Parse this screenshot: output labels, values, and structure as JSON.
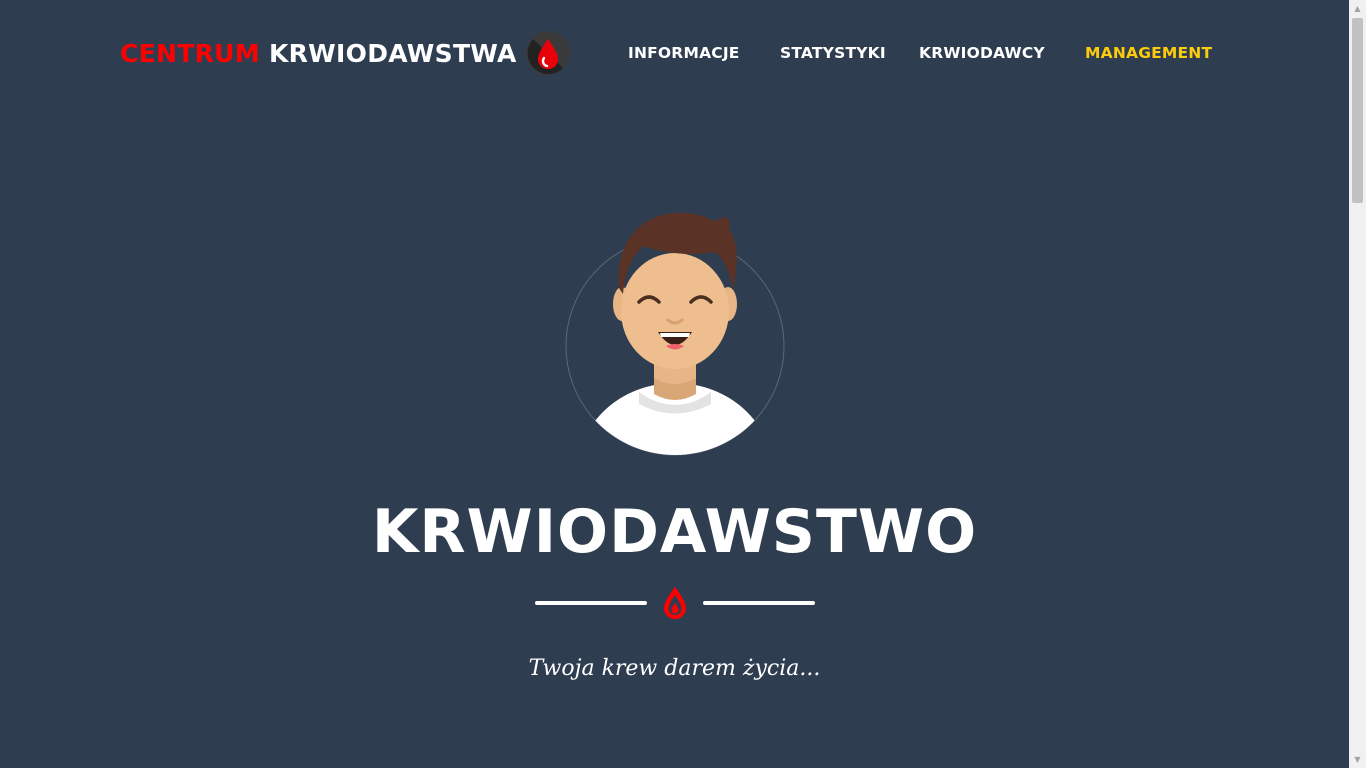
{
  "brand": {
    "part1": "CENTRUM",
    "part2": "KRWIODAWSTWA",
    "logo_icon": "blood-drop-icon"
  },
  "nav": {
    "items": [
      {
        "label": "INFORMACJE",
        "active": false
      },
      {
        "label": "STATYSTYKI",
        "active": false
      },
      {
        "label": "KRWIODAWCY",
        "active": false
      },
      {
        "label": "MANAGEMENT",
        "active": true
      }
    ]
  },
  "hero": {
    "avatar_icon": "smiling-man-avatar",
    "title": "KRWIODAWSTWO",
    "divider_icon": "blood-drop-icon",
    "subtitle": "Twoja krew darem życia..."
  },
  "colors": {
    "background": "#2e3d50",
    "brand_red": "#ff0000",
    "active_nav": "#fdcc0d",
    "text": "#ffffff"
  }
}
